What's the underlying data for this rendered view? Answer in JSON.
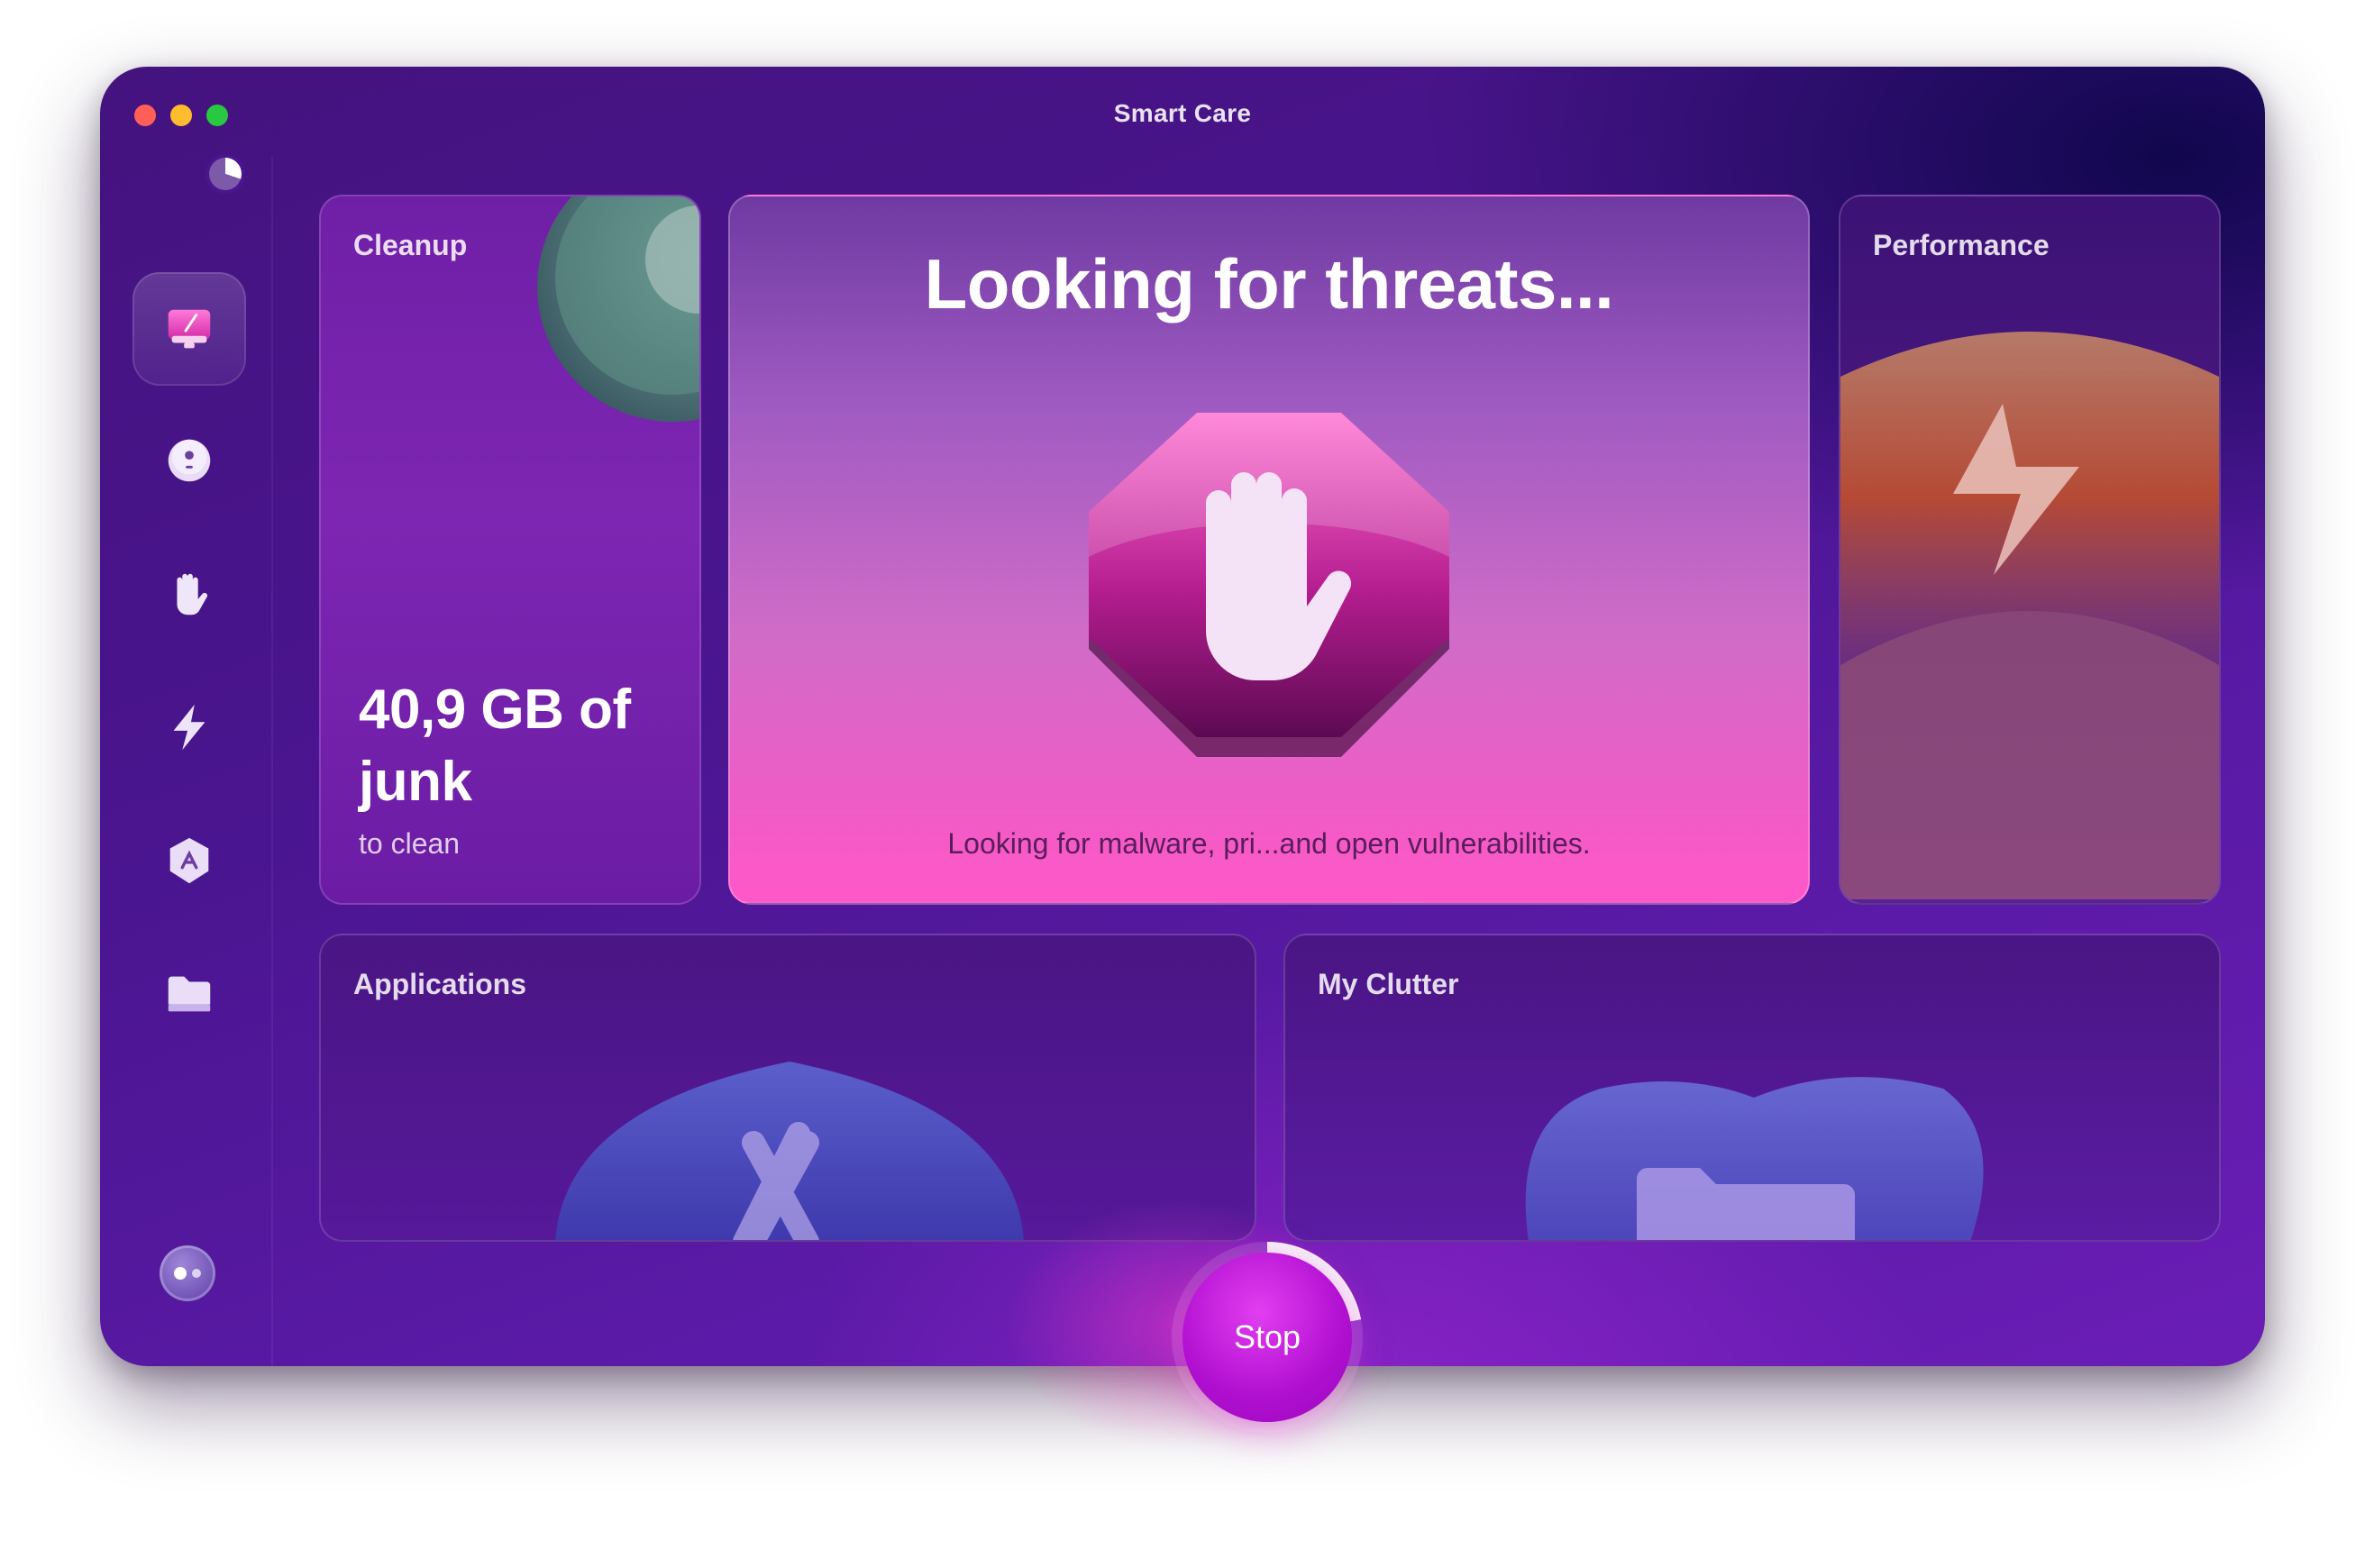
{
  "window": {
    "title": "Smart Care"
  },
  "sidebar": {
    "items": [
      {
        "icon": "smart-care-icon",
        "active": true
      },
      {
        "icon": "cleanup-icon"
      },
      {
        "icon": "protection-icon"
      },
      {
        "icon": "performance-icon"
      },
      {
        "icon": "applications-icon"
      },
      {
        "icon": "files-icon"
      }
    ],
    "assistant_icon": "assistant-icon"
  },
  "cards": {
    "cleanup": {
      "label": "Cleanup",
      "amount": "40,9 GB of junk",
      "caption": "to clean"
    },
    "protection": {
      "headline": "Looking for threats...",
      "description": "Looking for malware, pri...and open vulnerabilities."
    },
    "performance": {
      "label": "Performance"
    },
    "applications": {
      "label": "Applications"
    },
    "clutter": {
      "label": "My Clutter"
    }
  },
  "scan": {
    "button_label": "Stop"
  },
  "colors": {
    "accent": "#ff58c8",
    "window_bg": "#4a1590",
    "stop_button": "#b00fd0"
  }
}
